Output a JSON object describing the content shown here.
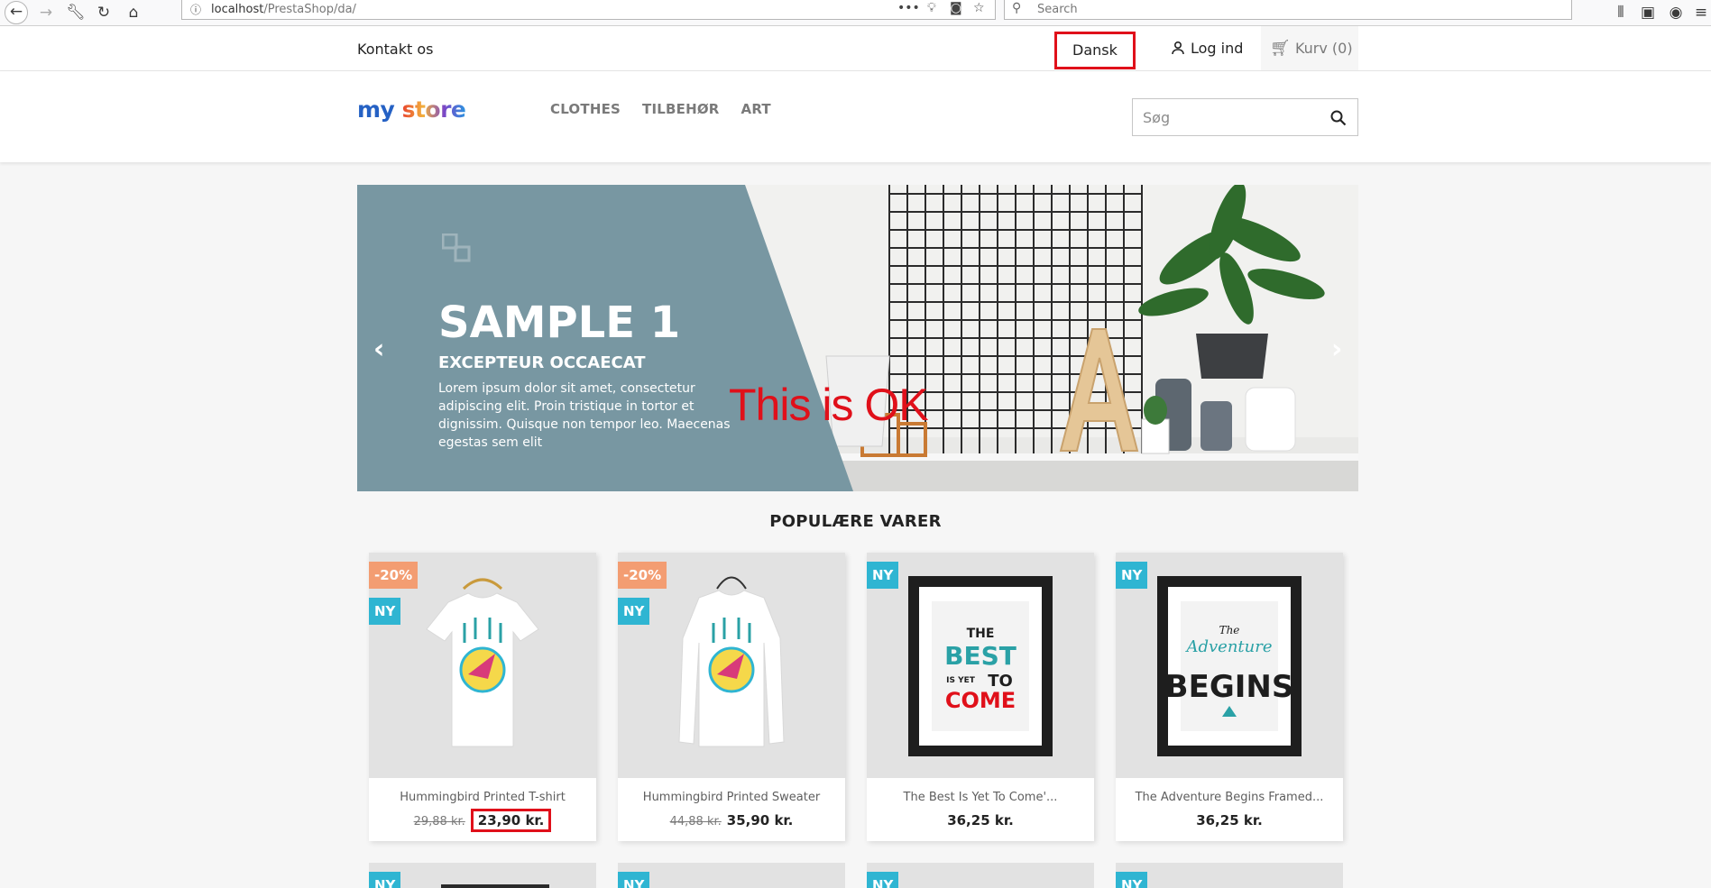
{
  "browser": {
    "url_host": "localhost",
    "url_path": "/PrestaShop/da/",
    "search_placeholder": "Search",
    "page_actions": "•••"
  },
  "nav": {
    "contact": "Kontakt os",
    "language": "Dansk",
    "login": "Log ind",
    "cart": "Kurv (0)"
  },
  "header": {
    "logo": {
      "p1": "my",
      "p2": "store"
    },
    "menu": [
      "CLOTHES",
      "TILBEHØR",
      "ART"
    ],
    "search_placeholder": "Søg"
  },
  "slider": {
    "title": "SAMPLE 1",
    "subtitle": "EXCEPTEUR OCCAECAT",
    "text": "Lorem ipsum dolor sit amet, consectetur adipiscing elit. Proin tristique in tortor et dignissim. Quisque non tempor leo. Maecenas egestas sem elit",
    "overlay_note": "This is OK"
  },
  "section_title": "POPULÆRE VARER",
  "products": [
    {
      "name": "Hummingbird Printed T-shirt",
      "old_price": "29,88 kr.",
      "price": "23,90 kr.",
      "discount": "-20%",
      "new": "NY",
      "price_highlighted": true
    },
    {
      "name": "Hummingbird Printed Sweater",
      "old_price": "44,88 kr.",
      "price": "35,90 kr.",
      "discount": "-20%",
      "new": "NY",
      "price_highlighted": false
    },
    {
      "name": "The Best Is Yet To Come'...",
      "old_price": "",
      "price": "36,25 kr.",
      "discount": "",
      "new": "NY",
      "price_highlighted": false
    },
    {
      "name": "The Adventure Begins Framed...",
      "old_price": "",
      "price": "36,25 kr.",
      "discount": "",
      "new": "NY",
      "price_highlighted": false
    }
  ],
  "second_row_flags": [
    "NY",
    "NY",
    "NY",
    "NY"
  ],
  "colors": {
    "highlight_red": "#e0101a",
    "discount_flag": "#f39d72",
    "new_flag": "#2fb5d2",
    "slider_panel": "#7897a2"
  },
  "poster1": {
    "line1": "THE",
    "line2": "BEST",
    "line3a": "IS YET",
    "line3b": "TO",
    "line4": "COME"
  },
  "poster2": {
    "line1": "The",
    "line2": "Adventure",
    "line3": "BEGINS"
  }
}
